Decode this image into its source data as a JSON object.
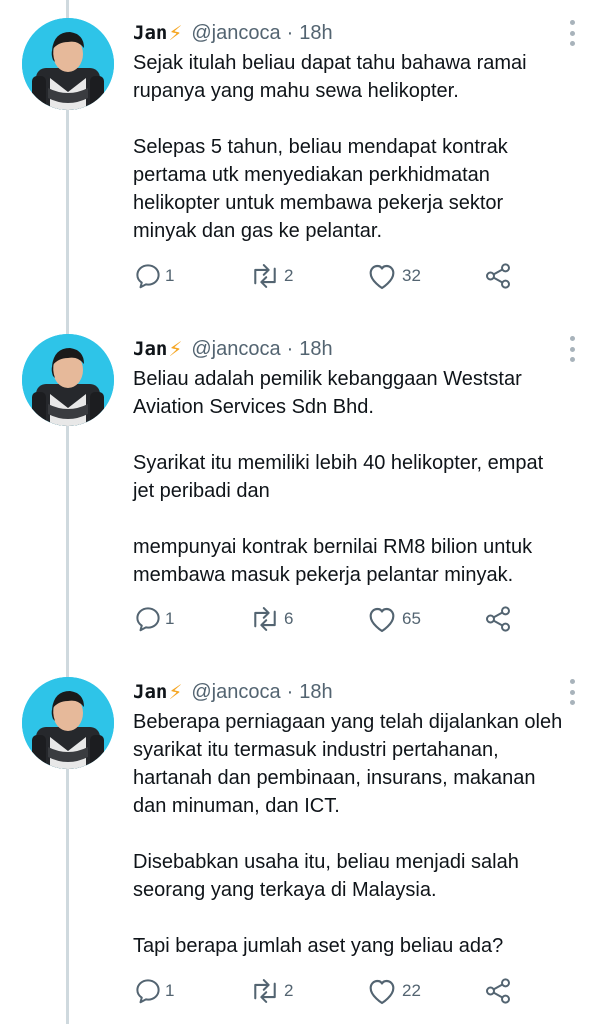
{
  "colors": {
    "thread_line": "#cfd9de",
    "avatar_bg": "#2ec4e8",
    "secondary_text": "#536471",
    "primary_text": "#0f1419"
  },
  "icons": {
    "reply": "reply-icon",
    "retweet": "retweet-icon",
    "like": "heart-icon",
    "share": "share-icon",
    "more": "more-vertical-icon",
    "badge": "lightning-emoji"
  },
  "tweets": [
    {
      "author": {
        "name": "Jan",
        "emoji": "⚡",
        "handle": "@jancoca",
        "separator": "·",
        "time": "18h"
      },
      "paragraphs": [
        "Sejak itulah beliau dapat tahu bahawa ramai\nrupanya yang mahu sewa helikopter.",
        "Selepas 5 tahun, beliau mendapat kontrak\npertama utk menyediakan perkhidmatan\nhelikopter untuk membawa pekerja sektor\nminyak dan gas ke pelantar."
      ],
      "stats": {
        "replies": "1",
        "retweets": "2",
        "likes": "32"
      }
    },
    {
      "author": {
        "name": "Jan",
        "emoji": "⚡",
        "handle": "@jancoca",
        "separator": "·",
        "time": "18h"
      },
      "paragraphs": [
        "Beliau adalah pemilik kebanggaan Weststar\nAviation Services Sdn Bhd.",
        "Syarikat itu memiliki lebih 40 helikopter, empat\njet peribadi dan",
        "mempunyai kontrak bernilai RM8 bilion untuk\nmembawa masuk pekerja pelantar minyak."
      ],
      "stats": {
        "replies": "1",
        "retweets": "6",
        "likes": "65"
      }
    },
    {
      "author": {
        "name": "Jan",
        "emoji": "⚡",
        "handle": "@jancoca",
        "separator": "·",
        "time": "18h"
      },
      "paragraphs": [
        "Beberapa perniagaan yang telah dijalankan oleh\nsyarikat itu termasuk industri pertahanan,\nhartanah dan pembinaan, insurans, makanan\ndan minuman, dan ICT.",
        "Disebabkan usaha itu, beliau menjadi salah\nseorang yang terkaya di Malaysia.",
        "Tapi berapa jumlah aset yang beliau ada?"
      ],
      "stats": {
        "replies": "1",
        "retweets": "2",
        "likes": "22"
      }
    }
  ]
}
